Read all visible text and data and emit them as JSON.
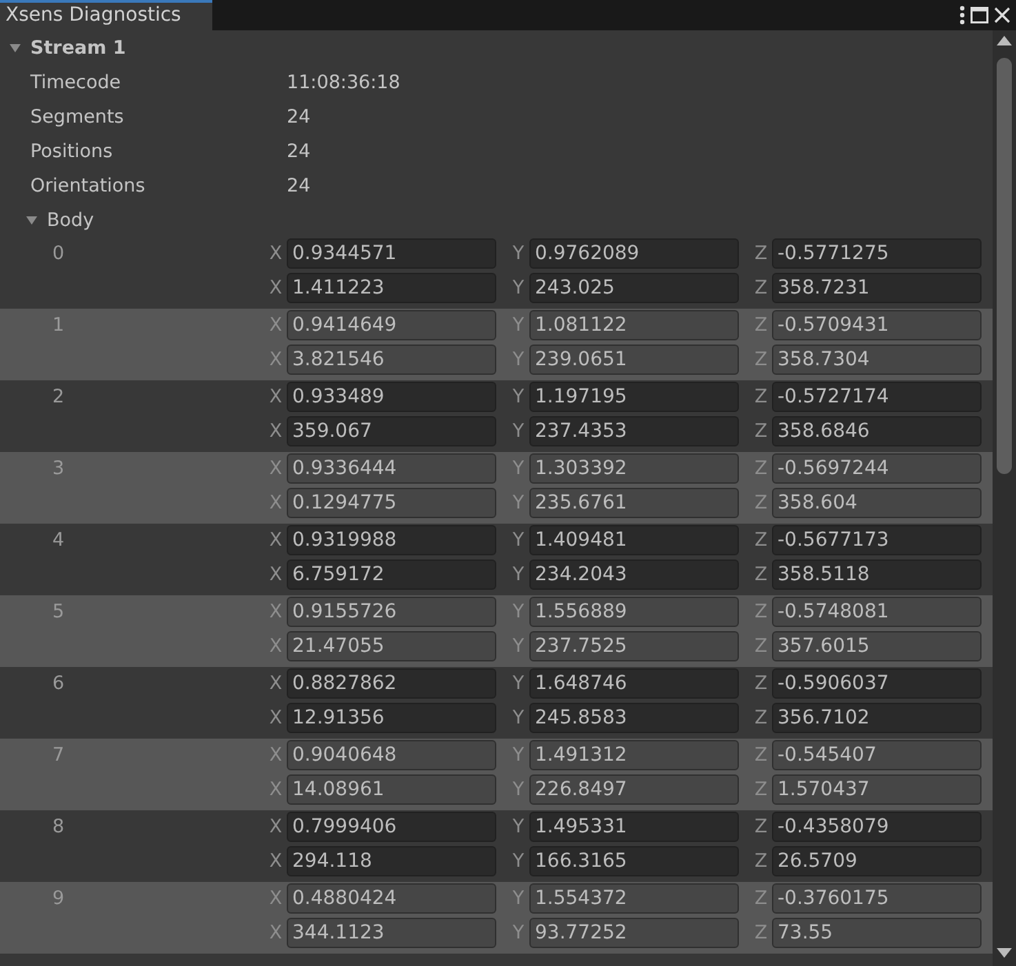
{
  "window": {
    "title": "Xsens Diagnostics"
  },
  "stream": {
    "title": "Stream 1",
    "expanded": true,
    "properties": [
      {
        "label": "Timecode",
        "value": "11:08:36:18"
      },
      {
        "label": "Segments",
        "value": "24"
      },
      {
        "label": "Positions",
        "value": "24"
      },
      {
        "label": "Orientations",
        "value": "24"
      }
    ],
    "body": {
      "title": "Body",
      "expanded": true,
      "segments": [
        {
          "index": "0",
          "lines": [
            [
              {
                "axis": "X",
                "value": "0.9344571"
              },
              {
                "axis": "Y",
                "value": "0.9762089"
              },
              {
                "axis": "Z",
                "value": "-0.5771275"
              }
            ],
            [
              {
                "axis": "X",
                "value": "1.411223"
              },
              {
                "axis": "Y",
                "value": "243.025"
              },
              {
                "axis": "Z",
                "value": "358.7231"
              }
            ]
          ]
        },
        {
          "index": "1",
          "lines": [
            [
              {
                "axis": "X",
                "value": "0.9414649"
              },
              {
                "axis": "Y",
                "value": "1.081122"
              },
              {
                "axis": "Z",
                "value": "-0.5709431"
              }
            ],
            [
              {
                "axis": "X",
                "value": "3.821546"
              },
              {
                "axis": "Y",
                "value": "239.0651"
              },
              {
                "axis": "Z",
                "value": "358.7304"
              }
            ]
          ]
        },
        {
          "index": "2",
          "lines": [
            [
              {
                "axis": "X",
                "value": "0.933489"
              },
              {
                "axis": "Y",
                "value": "1.197195"
              },
              {
                "axis": "Z",
                "value": "-0.5727174"
              }
            ],
            [
              {
                "axis": "X",
                "value": "359.067"
              },
              {
                "axis": "Y",
                "value": "237.4353"
              },
              {
                "axis": "Z",
                "value": "358.6846"
              }
            ]
          ]
        },
        {
          "index": "3",
          "lines": [
            [
              {
                "axis": "X",
                "value": "0.9336444"
              },
              {
                "axis": "Y",
                "value": "1.303392"
              },
              {
                "axis": "Z",
                "value": "-0.5697244"
              }
            ],
            [
              {
                "axis": "X",
                "value": "0.1294775"
              },
              {
                "axis": "Y",
                "value": "235.6761"
              },
              {
                "axis": "Z",
                "value": "358.604"
              }
            ]
          ]
        },
        {
          "index": "4",
          "lines": [
            [
              {
                "axis": "X",
                "value": "0.9319988"
              },
              {
                "axis": "Y",
                "value": "1.409481"
              },
              {
                "axis": "Z",
                "value": "-0.5677173"
              }
            ],
            [
              {
                "axis": "X",
                "value": "6.759172"
              },
              {
                "axis": "Y",
                "value": "234.2043"
              },
              {
                "axis": "Z",
                "value": "358.5118"
              }
            ]
          ]
        },
        {
          "index": "5",
          "lines": [
            [
              {
                "axis": "X",
                "value": "0.9155726"
              },
              {
                "axis": "Y",
                "value": "1.556889"
              },
              {
                "axis": "Z",
                "value": "-0.5748081"
              }
            ],
            [
              {
                "axis": "X",
                "value": "21.47055"
              },
              {
                "axis": "Y",
                "value": "237.7525"
              },
              {
                "axis": "Z",
                "value": "357.6015"
              }
            ]
          ]
        },
        {
          "index": "6",
          "lines": [
            [
              {
                "axis": "X",
                "value": "0.8827862"
              },
              {
                "axis": "Y",
                "value": "1.648746"
              },
              {
                "axis": "Z",
                "value": "-0.5906037"
              }
            ],
            [
              {
                "axis": "X",
                "value": "12.91356"
              },
              {
                "axis": "Y",
                "value": "245.8583"
              },
              {
                "axis": "Z",
                "value": "356.7102"
              }
            ]
          ]
        },
        {
          "index": "7",
          "lines": [
            [
              {
                "axis": "X",
                "value": "0.9040648"
              },
              {
                "axis": "Y",
                "value": "1.491312"
              },
              {
                "axis": "Z",
                "value": "-0.545407"
              }
            ],
            [
              {
                "axis": "X",
                "value": "14.08961"
              },
              {
                "axis": "Y",
                "value": "226.8497"
              },
              {
                "axis": "Z",
                "value": "1.570437"
              }
            ]
          ]
        },
        {
          "index": "8",
          "lines": [
            [
              {
                "axis": "X",
                "value": "0.7999406"
              },
              {
                "axis": "Y",
                "value": "1.495331"
              },
              {
                "axis": "Z",
                "value": "-0.4358079"
              }
            ],
            [
              {
                "axis": "X",
                "value": "294.118"
              },
              {
                "axis": "Y",
                "value": "166.3165"
              },
              {
                "axis": "Z",
                "value": "26.5709"
              }
            ]
          ]
        },
        {
          "index": "9",
          "lines": [
            [
              {
                "axis": "X",
                "value": "0.4880424"
              },
              {
                "axis": "Y",
                "value": "1.554372"
              },
              {
                "axis": "Z",
                "value": "-0.3760175"
              }
            ],
            [
              {
                "axis": "X",
                "value": "344.1123"
              },
              {
                "axis": "Y",
                "value": "93.77252"
              },
              {
                "axis": "Z",
                "value": "73.55"
              }
            ]
          ]
        }
      ]
    }
  }
}
